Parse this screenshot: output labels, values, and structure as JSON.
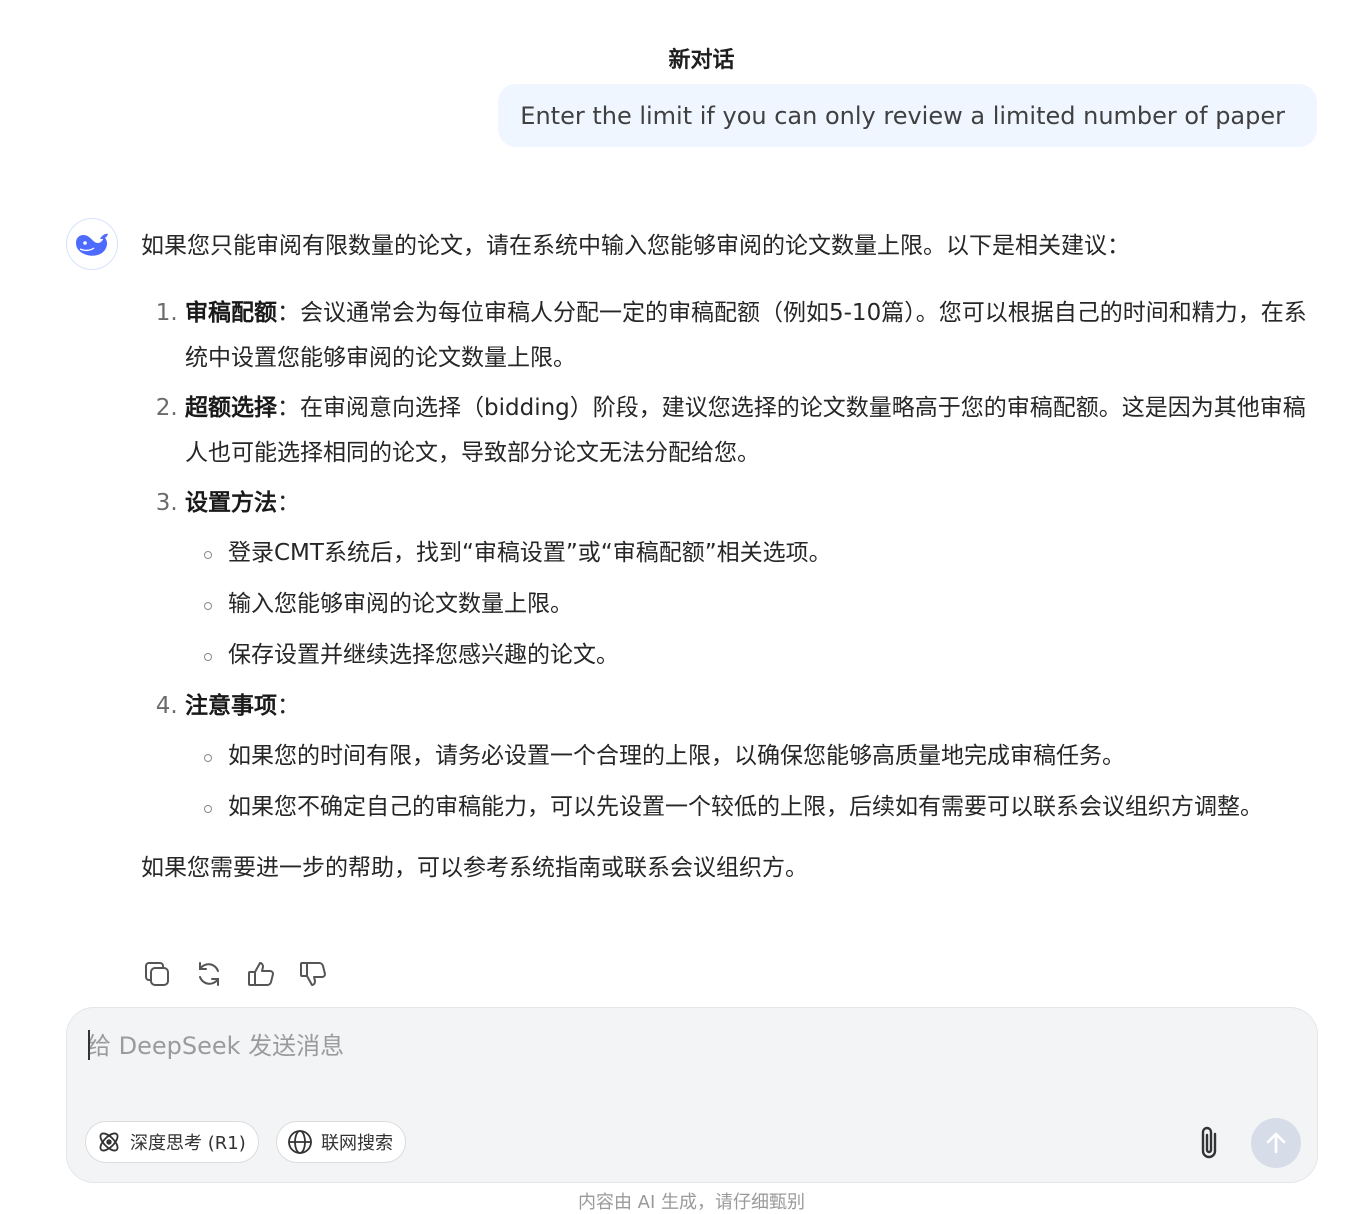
{
  "header": {
    "title": "新对话"
  },
  "user_message": "Enter the limit if you can only review a limited number of paper",
  "assistant": {
    "intro": "如果您只能审阅有限数量的论文，请在系统中输入您能够审阅的论文数量上限。以下是相关建议：",
    "items": [
      {
        "number": "1.",
        "heading": "审稿配额",
        "text": "：会议通常会为每位审稿人分配一定的审稿配额（例如5-10篇）。您可以根据自己的时间和精力，在系统中设置您能够审阅的论文数量上限。",
        "bullets": []
      },
      {
        "number": "2.",
        "heading": "超额选择",
        "text": "：在审阅意向选择（bidding）阶段，建议您选择的论文数量略高于您的审稿配额。这是因为其他审稿人也可能选择相同的论文，导致部分论文无法分配给您。",
        "bullets": []
      },
      {
        "number": "3.",
        "heading": "设置方法",
        "text": "：",
        "bullets": [
          "登录CMT系统后，找到“审稿设置”或“审稿配额”相关选项。",
          "输入您能够审阅的论文数量上限。",
          "保存设置并继续选择您感兴趣的论文。"
        ]
      },
      {
        "number": "4.",
        "heading": "注意事项",
        "text": "：",
        "bullets": [
          "如果您的时间有限，请务必设置一个合理的上限，以确保您能够高质量地完成审稿任务。",
          "如果您不确定自己的审稿能力，可以先设置一个较低的上限，后续如有需要可以联系会议组织方调整。"
        ]
      }
    ],
    "closing": "如果您需要进一步的帮助，可以参考系统指南或联系会议组织方。",
    "actions": [
      {
        "name": "copy-icon"
      },
      {
        "name": "regenerate-icon"
      },
      {
        "name": "thumbs-up-icon"
      },
      {
        "name": "thumbs-down-icon"
      }
    ]
  },
  "composer": {
    "placeholder": "给 DeepSeek 发送消息",
    "deep_think_label": "深度思考 (R1)",
    "web_search_label": "联网搜索",
    "attach_icon": "paperclip-icon",
    "send_icon": "arrow-up-icon"
  },
  "footer": {
    "disclaimer": "内容由 AI 生成，请仔细甄别"
  },
  "colors": {
    "user_bubble": "#eff6ff",
    "brand": "#4d6bfe",
    "send_disabled": "#d6dde9",
    "composer_bg": "#f3f4f6"
  }
}
